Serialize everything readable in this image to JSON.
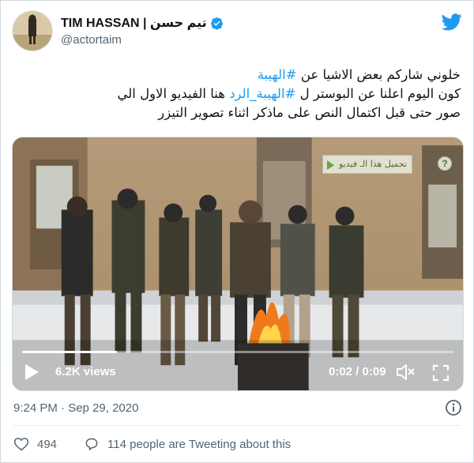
{
  "author": {
    "name": "TIM HASSAN | تيم حسن",
    "handle": "@actortaim",
    "verified": true
  },
  "tweet": {
    "lines": [
      {
        "pre": "خلوني شاركم بعض الاشيا عن ",
        "tag": "#الهيبة",
        "post": ""
      },
      {
        "pre": "كون اليوم اعلنا عن البوستر  ل ",
        "tag": "#الهيبة_الرد",
        "post": " هنا الفيديو الاول الي"
      },
      {
        "pre": "صور حتى قبل اكتمال النص على ماذكر اثناء تصوير التيزر",
        "tag": "",
        "post": ""
      }
    ]
  },
  "video": {
    "views_label": "6.2K views",
    "time_label": "0:02 / 0:09",
    "progress_fraction": 0.22,
    "overlay_download_label": "تحميل هذا الـ فيديو",
    "overlay_help_label": "?"
  },
  "meta": {
    "timestamp": "9:24 PM · Sep 29, 2020",
    "likes": "494",
    "conversation_label": "114 people are Tweeting about this"
  },
  "colors": {
    "accent": "#1d9bf0",
    "text": "#0f1419",
    "secondary": "#536471"
  }
}
